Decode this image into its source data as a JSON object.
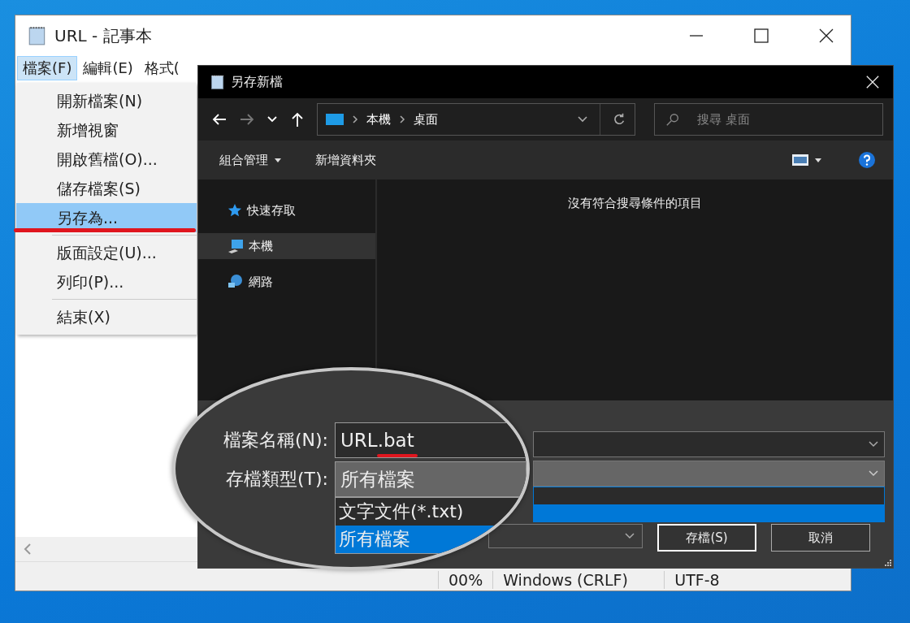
{
  "notepad": {
    "title": "URL - 記事本",
    "menu": [
      {
        "label": "檔案(F)",
        "selected": true
      },
      {
        "label": "編輯(E)",
        "selected": false
      },
      {
        "label": "格式(",
        "selected": false
      }
    ],
    "file_menu": [
      {
        "label": "開新檔案(N)",
        "selected": false,
        "separator_after": false
      },
      {
        "label": "新增視窗",
        "selected": false,
        "separator_after": false
      },
      {
        "label": "開啟舊檔(O)...",
        "selected": false,
        "separator_after": false
      },
      {
        "label": "儲存檔案(S)",
        "selected": false,
        "separator_after": false
      },
      {
        "label": "另存為...",
        "selected": true,
        "separator_after": true
      },
      {
        "label": "版面設定(U)...",
        "selected": false,
        "separator_after": false
      },
      {
        "label": "列印(P)...",
        "selected": false,
        "separator_after": true
      },
      {
        "label": "結束(X)",
        "selected": false,
        "separator_after": false
      }
    ],
    "status_bar": [
      "00%",
      "Windows (CRLF)",
      "UTF-8"
    ]
  },
  "dialog": {
    "title": "另存新檔",
    "breadcrumb": [
      "本機",
      "桌面"
    ],
    "search": {
      "placeholder": "搜尋 桌面"
    },
    "toolbar": [
      "組合管理",
      "新增資料夾"
    ],
    "sidebar": [
      {
        "label": "快速存取",
        "kind": "star",
        "selected": false
      },
      {
        "label": "本機",
        "kind": "computer",
        "selected": true
      },
      {
        "label": "網路",
        "kind": "network",
        "selected": false
      }
    ],
    "empty_message": "沒有符合搜尋條件的項目",
    "buttons": [
      "存檔(S)",
      "取消"
    ]
  },
  "magnifier": {
    "filename_label": "檔案名稱(N):",
    "filename": "URL.bat",
    "type_label": "存檔類型(T):",
    "type_value": "所有檔案",
    "type_options": [
      {
        "label": "文字文件(*.txt)",
        "selected": false
      },
      {
        "label": "所有檔案",
        "selected": true
      }
    ]
  }
}
